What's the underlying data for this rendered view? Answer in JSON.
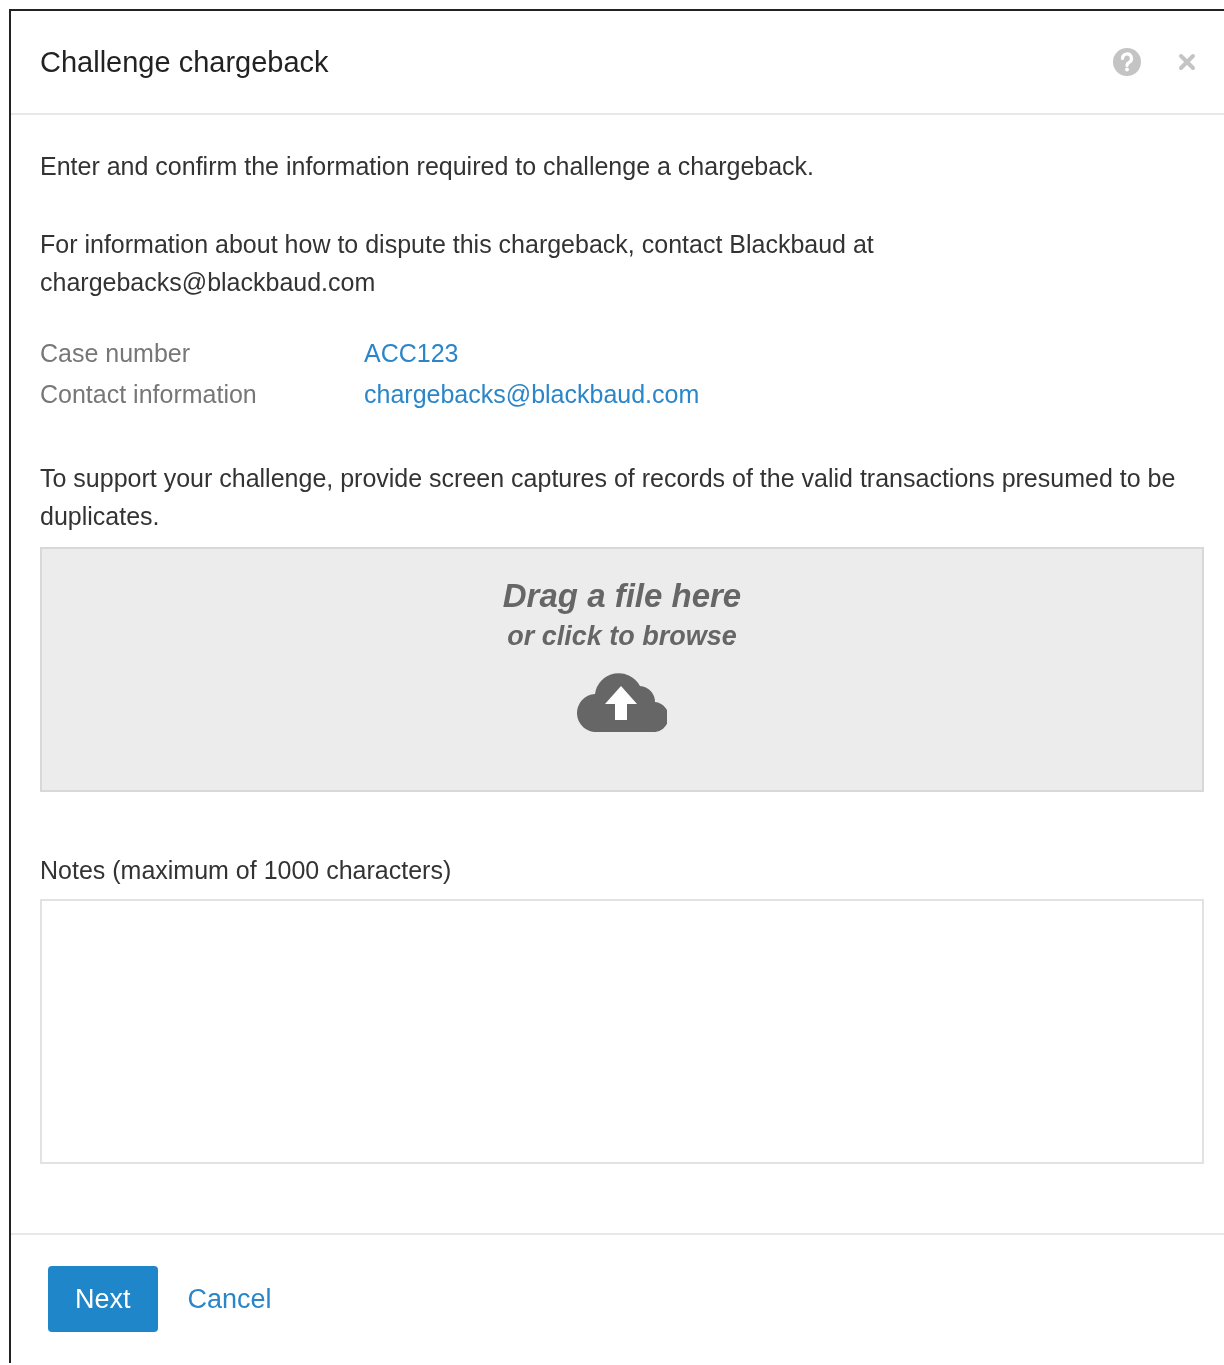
{
  "dialog": {
    "title": "Challenge chargeback"
  },
  "intro": "Enter and confirm the information required to challenge a chargeback.",
  "info": "For information about how to dispute this chargeback, contact Blackbaud at chargebacks@blackbaud.com",
  "details": [
    {
      "label": "Case number",
      "value": "ACC123"
    },
    {
      "label": "Contact information",
      "value": "chargebacks@blackbaud.com"
    }
  ],
  "support_text": "To support your challenge, provide screen captures of records of the valid transactions presumed to be duplicates.",
  "dropzone": {
    "title": "Drag a file here",
    "subtitle": "or click to browse"
  },
  "notes": {
    "label": "Notes (maximum of 1000 characters)"
  },
  "buttons": [
    {
      "label": "Next",
      "kind": "primary"
    },
    {
      "label": "Cancel",
      "kind": "link"
    }
  ]
}
